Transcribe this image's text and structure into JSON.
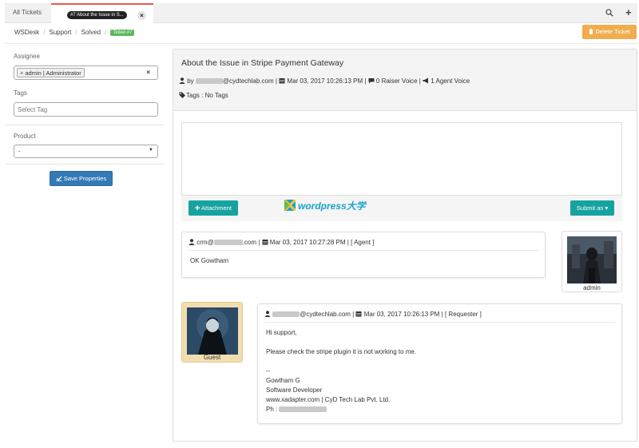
{
  "tabs": {
    "all_label": "All Tickets",
    "active_number": "#7",
    "active_label": "About the Issue in S...",
    "close_glyph": "×"
  },
  "toolbar": {
    "search_icon": "search-icon",
    "add_icon": "plus-icon",
    "add_glyph": "+"
  },
  "breadcrumb": [
    "WSDesk",
    "Support",
    "Solved"
  ],
  "breadcrumb_badge": "Ticket #7",
  "delete_button": "Delete Ticket",
  "sidebar": {
    "assignee_label": "Assignee",
    "assignee_value": "admin | Administrator",
    "assignee_remove": "×",
    "assignee_clear": "×",
    "tags_label": "Tags",
    "tags_placeholder": "Select Tag",
    "product_label": "Product",
    "product_value": "-",
    "save_button": "Save Properties"
  },
  "ticket": {
    "title": "About the Issue in Stripe Payment Gateway",
    "by_prefix": "by",
    "email_domain": "@cydtechlab.com |",
    "date": "Mar 03, 2017 10:26:13 PM |",
    "raiser_voice": "0 Raiser Voice |",
    "agent_voice": "1 Agent Voice",
    "tags_text": "Tags : No Tags"
  },
  "reply": {
    "attachment_button": "Attachment",
    "watermark": "wordpress大学",
    "submit_button": "Submit as"
  },
  "replies": [
    {
      "head_prefix": "crm@",
      "head_domain": ".com |",
      "date": "Mar 03, 2017 10:27:28 PM |",
      "role": "[ Agent ]",
      "body": [
        "OK Gowtham"
      ],
      "avatar_caption": "admin"
    },
    {
      "head_domain": "@cydtechlab.com |",
      "date": "Mar 03, 2017 10:26:13 PM |",
      "role": "[ Requester ]",
      "body": [
        "Hi support,",
        "Please check the stripe plugin it is not working to me.",
        "--",
        "Gowtham G",
        "Software Developer",
        "www.xadapter.com | CyD Tech Lab Pvt. Ltd.",
        "Ph :"
      ],
      "avatar_caption": "Guest"
    }
  ],
  "colors": {
    "active_tab_accent": "#e8584a",
    "primary_button": "#337ab7",
    "teal_button": "#17a2a2",
    "delete_button": "#f0ad4e",
    "badge_green": "#5cb85c",
    "guest_card": "#f2ddb0"
  }
}
